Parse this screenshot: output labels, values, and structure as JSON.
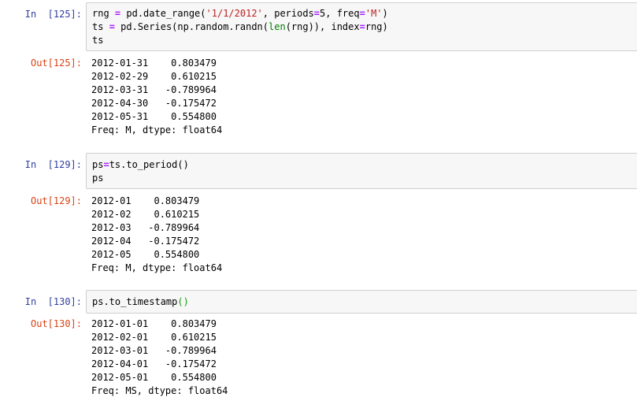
{
  "cells": [
    {
      "in_prompt": "In  [125]:",
      "out_prompt": "Out[125]:",
      "code": {
        "line1": {
          "a": "rng ",
          "eq1": "=",
          "b": " pd.date_range(",
          "str1": "'1/1/2012'",
          "c": ", periods",
          "eq2": "=",
          "d": "5, freq",
          "eq3": "=",
          "str2": "'M'",
          "e": ")"
        },
        "line2": {
          "a": "ts ",
          "eq1": "=",
          "b": " pd.Series(np.random.randn(",
          "fn1": "len",
          "c": "(rng)), index",
          "eq2": "=",
          "d": "rng)"
        },
        "line3": "ts"
      },
      "output": [
        "2012-01-31    0.803479",
        "2012-02-29    0.610215",
        "2012-03-31   -0.789964",
        "2012-04-30   -0.175472",
        "2012-05-31    0.554800",
        "Freq: M, dtype: float64"
      ]
    },
    {
      "in_prompt": "In  [129]:",
      "out_prompt": "Out[129]:",
      "code": {
        "line1": {
          "a": "ps",
          "eq1": "=",
          "b": "ts.to_period()"
        },
        "line2": "ps"
      },
      "output": [
        "2012-01    0.803479",
        "2012-02    0.610215",
        "2012-03   -0.789964",
        "2012-04   -0.175472",
        "2012-05    0.554800",
        "Freq: M, dtype: float64"
      ]
    },
    {
      "in_prompt": "In  [130]:",
      "out_prompt": "Out[130]:",
      "code": {
        "line1": {
          "a": "ps.to_timestamp",
          "p": "()"
        }
      },
      "output": [
        "2012-01-01    0.803479",
        "2012-02-01    0.610215",
        "2012-03-01   -0.789964",
        "2012-04-01   -0.175472",
        "2012-05-01    0.554800",
        "Freq: MS, dtype: float64"
      ]
    }
  ]
}
